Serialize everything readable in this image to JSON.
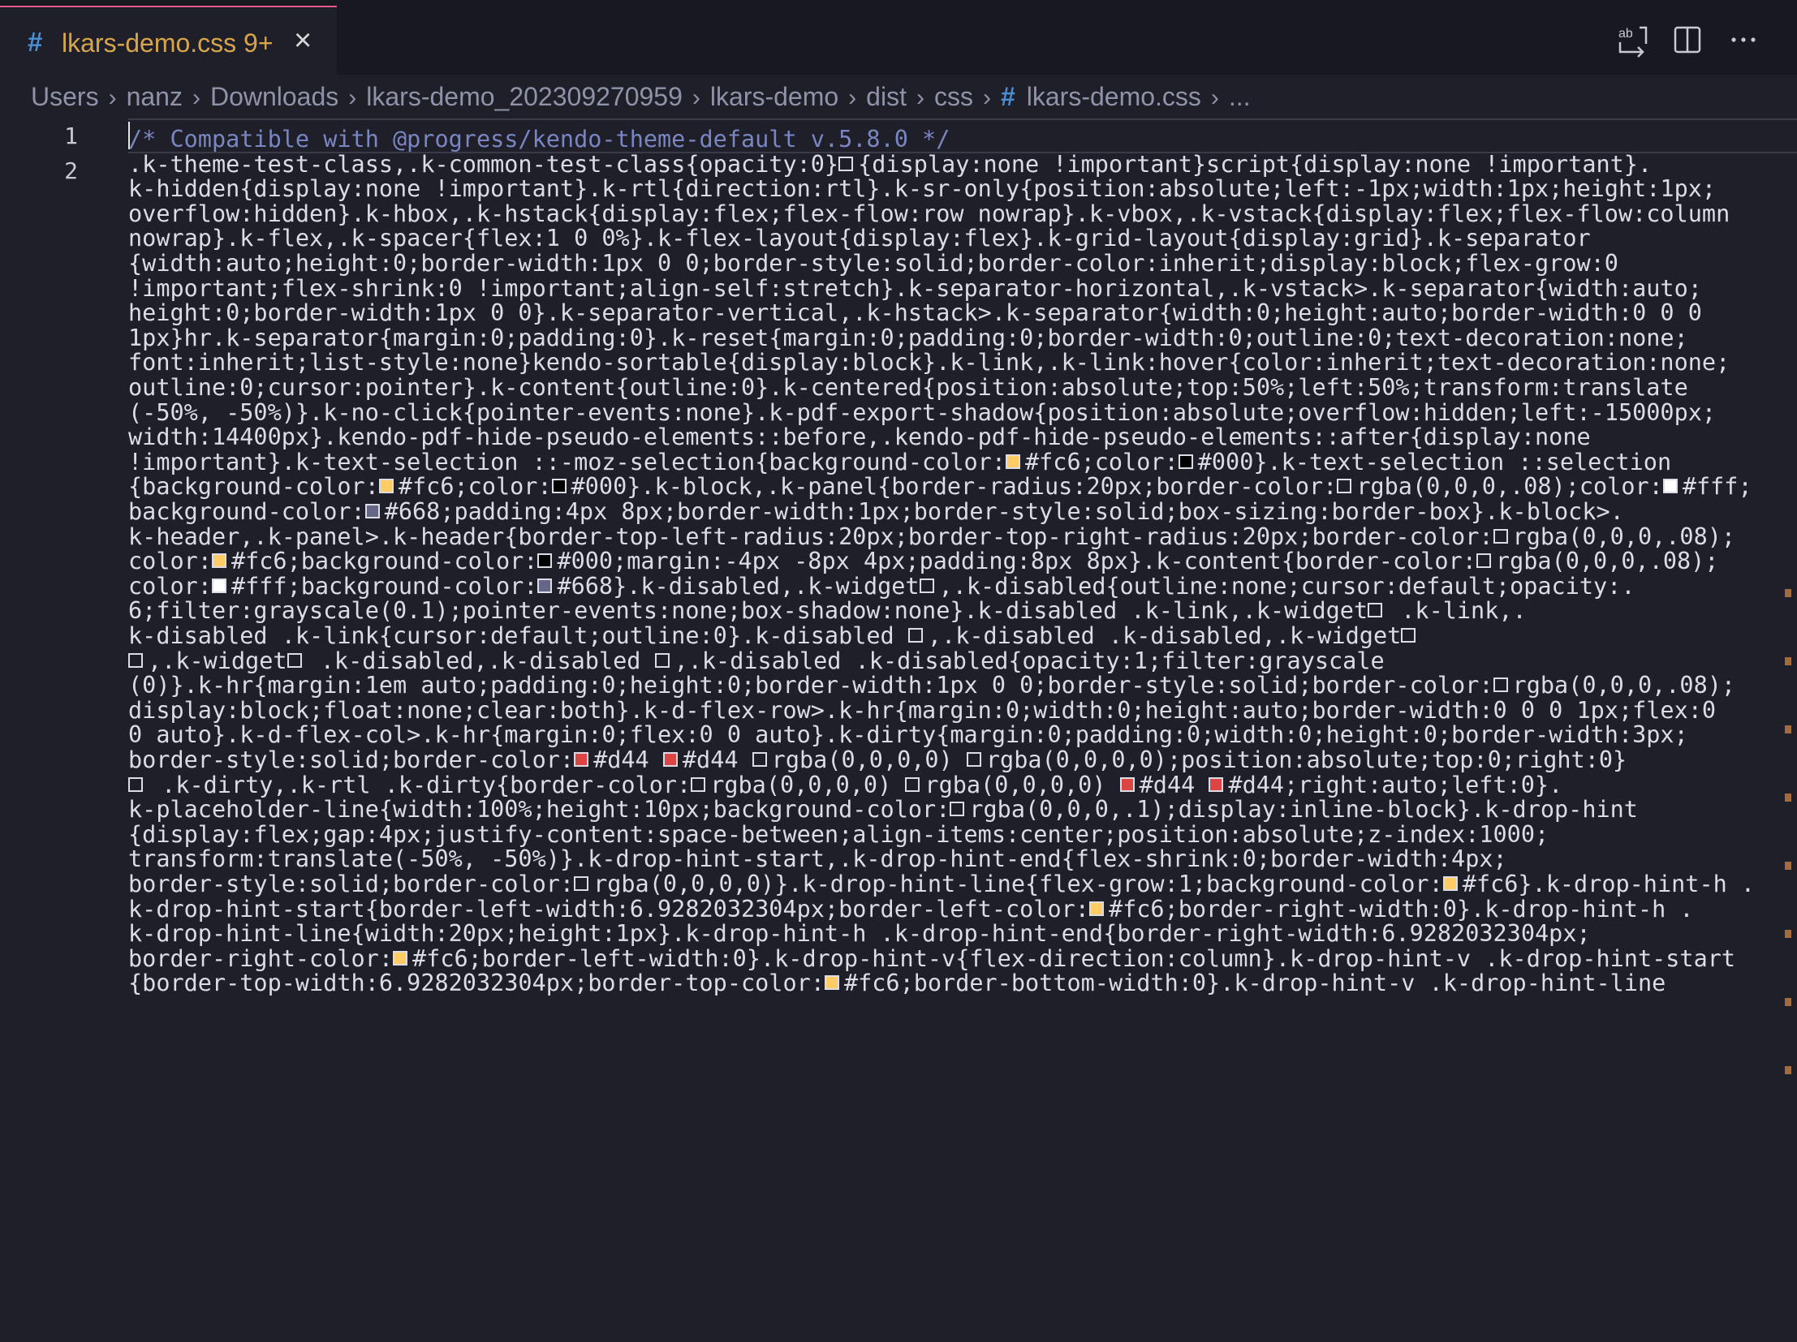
{
  "tab": {
    "title": "lkars-demo.css 9+",
    "hash": "#",
    "close": "×"
  },
  "toolbar_icons": [
    "compare-changes-icon",
    "split-editor-icon",
    "more-actions-icon"
  ],
  "breadcrumb": [
    "Users",
    "nanz",
    "Downloads",
    "lkars-demo_202309270959",
    "lkars-demo",
    "dist",
    "css",
    "lkars-demo.css",
    "..."
  ],
  "line_numbers": [
    "1",
    "2"
  ],
  "code_lines": [
    {
      "text": "/* Compatible with @progress/kendo-theme-default v.5.8.0 */",
      "type": "comment"
    },
    {
      "text": ".k-theme-test-class,.k-common-test-class{opacity:0}[hidden]{display:none !important}script{display:none !important}."
    },
    {
      "text": "k-hidden{display:none !important}.k-rtl{direction:rtl}.k-sr-only{position:absolute;left:-1px;width:1px;height:1px;"
    },
    {
      "text": "overflow:hidden}.k-hbox,.k-hstack{display:flex;flex-flow:row nowrap}.k-vbox,.k-vstack{display:flex;flex-flow:column"
    },
    {
      "text": "nowrap}.k-flex,.k-spacer{flex:1 0 0%}.k-flex-layout{display:flex}.k-grid-layout{display:grid}.k-separator"
    },
    {
      "text": "{width:auto;height:0;border-width:1px 0 0;border-style:solid;border-color:inherit;display:block;flex-grow:0"
    },
    {
      "text": "!important;flex-shrink:0 !important;align-self:stretch}.k-separator-horizontal,.k-vstack>.k-separator{width:auto;"
    },
    {
      "text": "height:0;border-width:1px 0 0}.k-separator-vertical,.k-hstack>.k-separator{width:0;height:auto;border-width:0 0 0"
    },
    {
      "text": "1px}hr.k-separator{margin:0;padding:0}.k-reset{margin:0;padding:0;border-width:0;outline:0;text-decoration:none;"
    },
    {
      "text": "font:inherit;list-style:none}kendo-sortable{display:block}.k-link,.k-link:hover{color:inherit;text-decoration:none;"
    },
    {
      "text": "outline:0;cursor:pointer}.k-content{outline:0}.k-centered{position:absolute;top:50%;left:50%;transform:translate"
    },
    {
      "text": "(-50%, -50%)}.k-no-click{pointer-events:none}.k-pdf-export-shadow{position:absolute;overflow:hidden;left:-15000px;"
    },
    {
      "text": "width:14400px}.kendo-pdf-hide-pseudo-elements::before,.kendo-pdf-hide-pseudo-elements::after{display:none"
    },
    {
      "text": "!important}.k-text-selection ::-moz-selection{background-color:[#fc6]#fc6;color:[#000]#000}.k-text-selection ::selection"
    },
    {
      "text": "{background-color:[#fc6]#fc6;color:[#000]#000}.k-block,.k-panel{border-radius:20px;border-color:[rgba(0,0,0,.08)]rgba(0,0,0,.08);color:[#fff]#fff;"
    },
    {
      "text": "background-color:[#668]#668;padding:4px 8px;border-width:1px;border-style:solid;box-sizing:border-box}.k-block>."
    },
    {
      "text": "k-header,.k-panel>.k-header{border-top-left-radius:20px;border-top-right-radius:20px;border-color:[rgba(0,0,0,.08)]rgba(0,0,0,.08);"
    },
    {
      "text": "color:[#fc6]#fc6;background-color:[#000]#000;margin:-4px -8px 4px;padding:8px 8px}.k-content{border-color:[rgba(0,0,0,.08)]rgba(0,0,0,.08);"
    },
    {
      "text": "color:[#fff]#fff;background-color:[#668]#668}.k-disabled,.k-widget[disabled],.k-disabled{outline:none;cursor:default;opacity:."
    },
    {
      "text": "6;filter:grayscale(0.1);pointer-events:none;box-shadow:none}.k-disabled .k-link,.k-widget[disabled] .k-link,."
    },
    {
      "text": "k-disabled .k-link{cursor:default;outline:0}.k-disabled [disabled],.k-disabled .k-disabled,.k-widget[disabled]"
    },
    {
      "text": "[disabled],.k-widget[disabled] .k-disabled,.k-disabled [disabled],.k-disabled .k-disabled{opacity:1;filter:grayscale"
    },
    {
      "text": "(0)}.k-hr{margin:1em auto;padding:0;height:0;border-width:1px 0 0;border-style:solid;border-color:[rgba(0,0,0,.08)]rgba(0,0,0,.08);"
    },
    {
      "text": "display:block;float:none;clear:both}.k-d-flex-row>.k-hr{margin:0;width:0;height:auto;border-width:0 0 0 1px;flex:0"
    },
    {
      "text": "0 auto}.k-d-flex-col>.k-hr{margin:0;flex:0 0 auto}.k-dirty{margin:0;padding:0;width:0;height:0;border-width:3px;"
    },
    {
      "text": "border-style:solid;border-color:[#d44]#d44 [#d44]#d44 [rgba(0,0,0,0)]rgba(0,0,0,0) [rgba(0,0,0,0)]rgba(0,0,0,0);position:absolute;top:0;right:0}"
    },
    {
      "text": "[dir=rtl] .k-dirty,.k-rtl .k-dirty{border-color:[rgba(0,0,0,0)]rgba(0,0,0,0) [rgba(0,0,0,0)]rgba(0,0,0,0) [#d44]#d44 [#d44]#d44;right:auto;left:0}."
    },
    {
      "text": "k-placeholder-line{width:100%;height:10px;background-color:[rgba(0,0,0,.1)]rgba(0,0,0,.1);display:inline-block}.k-drop-hint"
    },
    {
      "text": "{display:flex;gap:4px;justify-content:space-between;align-items:center;position:absolute;z-index:1000;"
    },
    {
      "text": "transform:translate(-50%, -50%)}.k-drop-hint-start,.k-drop-hint-end{flex-shrink:0;border-width:4px;"
    },
    {
      "text": "border-style:solid;border-color:[rgba(0,0,0,0)]rgba(0,0,0,0)}.k-drop-hint-line{flex-grow:1;background-color:[#fc6]#fc6}.k-drop-hint-h ."
    },
    {
      "text": "k-drop-hint-start{border-left-width:6.9282032304px;border-left-color:[#fc6]#fc6;border-right-width:0}.k-drop-hint-h ."
    },
    {
      "text": "k-drop-hint-line{width:20px;height:1px}.k-drop-hint-h .k-drop-hint-end{border-right-width:6.9282032304px;"
    },
    {
      "text": "border-right-color:[#fc6]#fc6;border-left-width:0}.k-drop-hint-v{flex-direction:column}.k-drop-hint-v .k-drop-hint-start"
    },
    {
      "text": "{border-top-width:6.9282032304px;border-top-color:[#fc6]#fc6;border-bottom-width:0}.k-drop-hint-v .k-drop-hint-line"
    }
  ],
  "swatch_colors": {
    "#fc6": "#ffcc66",
    "#000": "#000000",
    "#fff": "#ffffff",
    "#668": "#666688",
    "#d44": "#dd4444",
    "rgba(0,0,0,.08)": "transparent",
    "rgba(0,0,0,0)": "transparent",
    "rgba(0,0,0,.1)": "transparent"
  },
  "colors": {
    "background": "#1f1f29",
    "tab_accent": "#e05a8a",
    "css_icon": "#4a8fd6",
    "modified_title": "#d8a54a",
    "comment": "#7a86c2",
    "overview_mark": "#a46b3c"
  },
  "overview_marks": 8
}
